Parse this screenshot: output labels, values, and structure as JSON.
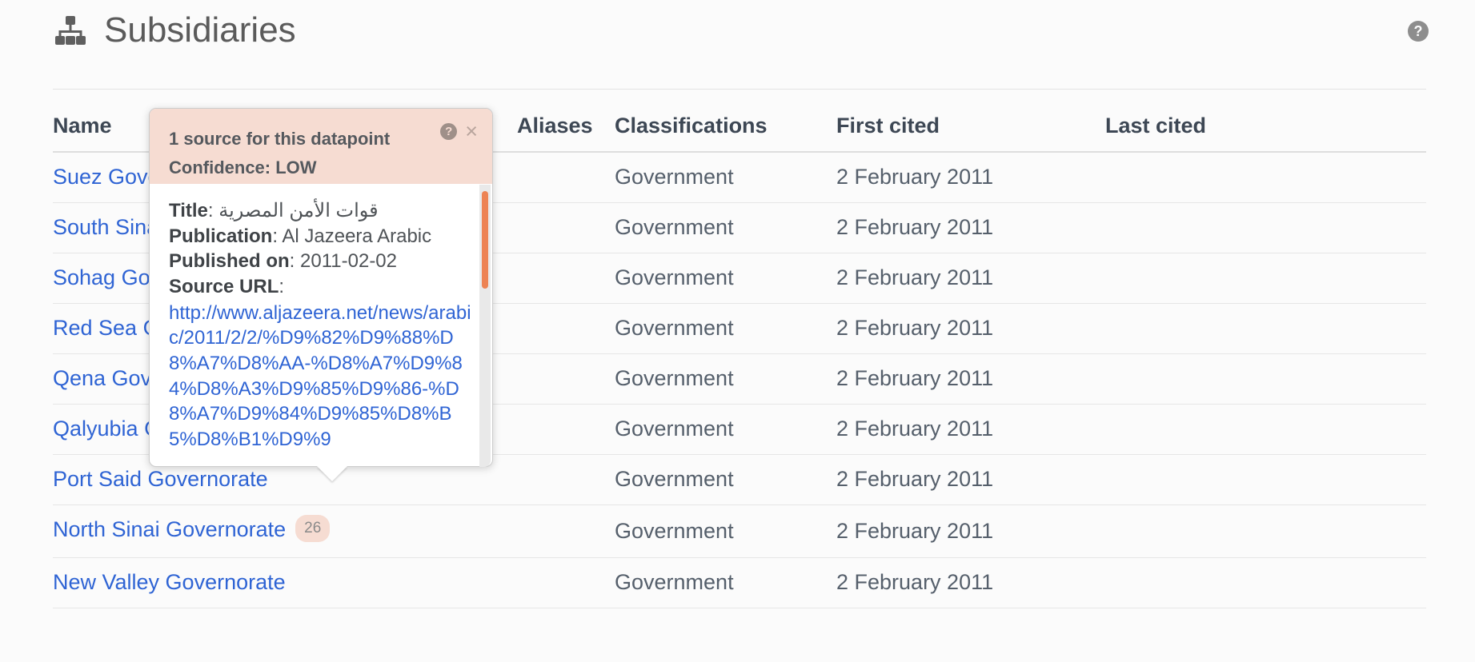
{
  "header": {
    "title": "Subsidiaries",
    "icon": "sitemap-icon",
    "help_icon": "help-circle-icon",
    "help_glyph": "?"
  },
  "table": {
    "columns": [
      "Name",
      "Aliases",
      "Classifications",
      "First cited",
      "Last cited"
    ],
    "rows": [
      {
        "name": "Suez Governorate",
        "aliases": "",
        "classification": "Government",
        "first_cited": "2 February 2011",
        "last_cited": "",
        "badge": ""
      },
      {
        "name": "South Sinai Governorate",
        "aliases": "",
        "classification": "Government",
        "first_cited": "2 February 2011",
        "last_cited": "",
        "badge": ""
      },
      {
        "name": "Sohag Governorate",
        "aliases": "",
        "classification": "Government",
        "first_cited": "2 February 2011",
        "last_cited": "",
        "badge": ""
      },
      {
        "name": "Red Sea Governorate",
        "aliases": "",
        "classification": "Government",
        "first_cited": "2 February 2011",
        "last_cited": "",
        "badge": ""
      },
      {
        "name": "Qena Governorate",
        "aliases": "",
        "classification": "Government",
        "first_cited": "2 February 2011",
        "last_cited": "",
        "badge": ""
      },
      {
        "name": "Qalyubia Governorate",
        "aliases": "",
        "classification": "Government",
        "first_cited": "2 February 2011",
        "last_cited": "",
        "badge": ""
      },
      {
        "name": "Port Said Governorate",
        "aliases": "",
        "classification": "Government",
        "first_cited": "2 February 2011",
        "last_cited": "",
        "badge": ""
      },
      {
        "name": "North Sinai Governorate",
        "aliases": "",
        "classification": "Government",
        "first_cited": "2 February 2011",
        "last_cited": "",
        "badge": "26"
      },
      {
        "name": "New Valley Governorate",
        "aliases": "",
        "classification": "Government",
        "first_cited": "2 February 2011",
        "last_cited": "",
        "badge": ""
      }
    ]
  },
  "popover": {
    "source_count_text": "1 source for this datapoint",
    "confidence_text": "Confidence: LOW",
    "help_glyph": "?",
    "close_glyph": "×",
    "labels": {
      "title": "Title",
      "publication": "Publication",
      "published_on": "Published on",
      "source_url": "Source URL"
    },
    "values": {
      "title": "قوات الأمن المصرية",
      "publication": "Al Jazeera Arabic",
      "published_on": "2011-02-02",
      "source_url": "http://www.aljazeera.net/news/arabic/2011/2/2/%D9%82%D9%88%D8%A7%D8%AA-%D8%A7%D9%84%D8%A3%D9%85%D9%86-%D8%A7%D9%84%D9%85%D8%B5%D8%B1%D9%9"
    }
  },
  "colors": {
    "accent_pink": "#f6dcd2",
    "link_blue": "#2f64d4",
    "scrollbar_orange": "#ed8354",
    "text_dark": "#3d4754",
    "page_bg": "#fbfbfb"
  }
}
